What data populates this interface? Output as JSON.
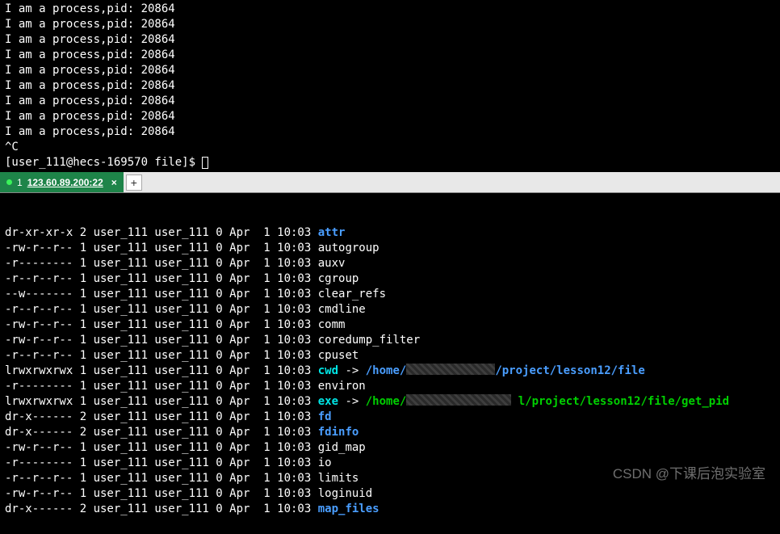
{
  "top": {
    "process_line": "I am a process,pid: 20864",
    "process_repeat": 9,
    "interrupt": "^C",
    "prompt": "[user_111@hecs-169570 file]$ "
  },
  "tab": {
    "index": "1",
    "label": "123.60.89.200:22",
    "close": "×",
    "add": "+"
  },
  "ls": {
    "rows": [
      {
        "perm": "dr-xr-xr-x",
        "links": "2",
        "user": "user_111",
        "group": "user_111",
        "size": "0",
        "month": "Apr",
        "day": "1",
        "time": "10:03",
        "name": "attr",
        "type": "dir"
      },
      {
        "perm": "-rw-r--r--",
        "links": "1",
        "user": "user_111",
        "group": "user_111",
        "size": "0",
        "month": "Apr",
        "day": "1",
        "time": "10:03",
        "name": "autogroup",
        "type": "file"
      },
      {
        "perm": "-r--------",
        "links": "1",
        "user": "user_111",
        "group": "user_111",
        "size": "0",
        "month": "Apr",
        "day": "1",
        "time": "10:03",
        "name": "auxv",
        "type": "file"
      },
      {
        "perm": "-r--r--r--",
        "links": "1",
        "user": "user_111",
        "group": "user_111",
        "size": "0",
        "month": "Apr",
        "day": "1",
        "time": "10:03",
        "name": "cgroup",
        "type": "file"
      },
      {
        "perm": "--w-------",
        "links": "1",
        "user": "user_111",
        "group": "user_111",
        "size": "0",
        "month": "Apr",
        "day": "1",
        "time": "10:03",
        "name": "clear_refs",
        "type": "file"
      },
      {
        "perm": "-r--r--r--",
        "links": "1",
        "user": "user_111",
        "group": "user_111",
        "size": "0",
        "month": "Apr",
        "day": "1",
        "time": "10:03",
        "name": "cmdline",
        "type": "file"
      },
      {
        "perm": "-rw-r--r--",
        "links": "1",
        "user": "user_111",
        "group": "user_111",
        "size": "0",
        "month": "Apr",
        "day": "1",
        "time": "10:03",
        "name": "comm",
        "type": "file"
      },
      {
        "perm": "-rw-r--r--",
        "links": "1",
        "user": "user_111",
        "group": "user_111",
        "size": "0",
        "month": "Apr",
        "day": "1",
        "time": "10:03",
        "name": "coredump_filter",
        "type": "file"
      },
      {
        "perm": "-r--r--r--",
        "links": "1",
        "user": "user_111",
        "group": "user_111",
        "size": "0",
        "month": "Apr",
        "day": "1",
        "time": "10:03",
        "name": "cpuset",
        "type": "file"
      },
      {
        "perm": "lrwxrwxrwx",
        "links": "1",
        "user": "user_111",
        "group": "user_111",
        "size": "0",
        "month": "Apr",
        "day": "1",
        "time": "10:03",
        "name": "cwd",
        "type": "link",
        "link_color": "blue",
        "target_prefix": "/home/",
        "target_suffix": "/project/lesson12/file"
      },
      {
        "perm": "-r--------",
        "links": "1",
        "user": "user_111",
        "group": "user_111",
        "size": "0",
        "month": "Apr",
        "day": "1",
        "time": "10:03",
        "name": "environ",
        "type": "file"
      },
      {
        "perm": "lrwxrwxrwx",
        "links": "1",
        "user": "user_111",
        "group": "user_111",
        "size": "0",
        "month": "Apr",
        "day": "1",
        "time": "10:03",
        "name": "exe",
        "type": "link",
        "link_color": "green",
        "target_prefix": "/home/",
        "target_mid": " l",
        "target_suffix": "/project/lesson12/file/get_pid"
      },
      {
        "perm": "dr-x------",
        "links": "2",
        "user": "user_111",
        "group": "user_111",
        "size": "0",
        "month": "Apr",
        "day": "1",
        "time": "10:03",
        "name": "fd",
        "type": "dir"
      },
      {
        "perm": "dr-x------",
        "links": "2",
        "user": "user_111",
        "group": "user_111",
        "size": "0",
        "month": "Apr",
        "day": "1",
        "time": "10:03",
        "name": "fdinfo",
        "type": "dir"
      },
      {
        "perm": "-rw-r--r--",
        "links": "1",
        "user": "user_111",
        "group": "user_111",
        "size": "0",
        "month": "Apr",
        "day": "1",
        "time": "10:03",
        "name": "gid_map",
        "type": "file"
      },
      {
        "perm": "-r--------",
        "links": "1",
        "user": "user_111",
        "group": "user_111",
        "size": "0",
        "month": "Apr",
        "day": "1",
        "time": "10:03",
        "name": "io",
        "type": "file"
      },
      {
        "perm": "-r--r--r--",
        "links": "1",
        "user": "user_111",
        "group": "user_111",
        "size": "0",
        "month": "Apr",
        "day": "1",
        "time": "10:03",
        "name": "limits",
        "type": "file"
      },
      {
        "perm": "-rw-r--r--",
        "links": "1",
        "user": "user_111",
        "group": "user_111",
        "size": "0",
        "month": "Apr",
        "day": "1",
        "time": "10:03",
        "name": "loginuid",
        "type": "file"
      },
      {
        "perm": "dr-x------",
        "links": "2",
        "user": "user_111",
        "group": "user_111",
        "size": "0",
        "month": "Apr",
        "day": "1",
        "time": "10:03",
        "name": "map_files",
        "type": "dir"
      }
    ]
  },
  "watermark": "CSDN @下课后泡实验室"
}
